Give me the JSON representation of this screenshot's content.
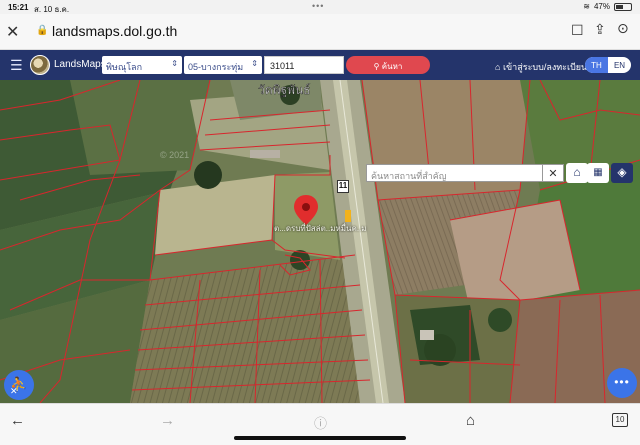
{
  "status_bar": {
    "time": "15:21",
    "date": "ส. 10 ธ.ค.",
    "dots": "•••",
    "battery": "47%"
  },
  "browser": {
    "close_label": "✕",
    "lock_glyph": "🔒",
    "domain": "landsmaps.dol.go.th",
    "bookmark_glyph": "☐",
    "share_glyph": "⇪",
    "more_glyph": "⊙"
  },
  "app": {
    "brand": "LandsMaps",
    "province": "พิษณุโลก",
    "district": "05-บางกระทุ่ม",
    "parcel_number": "31011",
    "search_label": "ค้นหา",
    "login_label": "เข้าสู่ระบบ/ลงทะเบียน",
    "lang_th": "TH",
    "lang_en": "EN"
  },
  "map": {
    "place_search_placeholder": "ค้นหาสถานที่สำคัญ",
    "place_search_clear": "✕",
    "place_name": "วัดพิฐพันธ์",
    "road_number": "11",
    "pin_label": "ต...ดรบที่ปัสล่ต..มหมื่นค..ม",
    "watermark": "© 2021"
  },
  "toolbar": {
    "back": "←",
    "forward": "→",
    "reader": "ⓘ",
    "home": "⌂",
    "tabs_count": "10"
  },
  "colors": {
    "header_bg": "#24346b",
    "accent_blue": "#3b74e8",
    "search_red": "#e0484f",
    "parcel_line": "#d8262d"
  }
}
